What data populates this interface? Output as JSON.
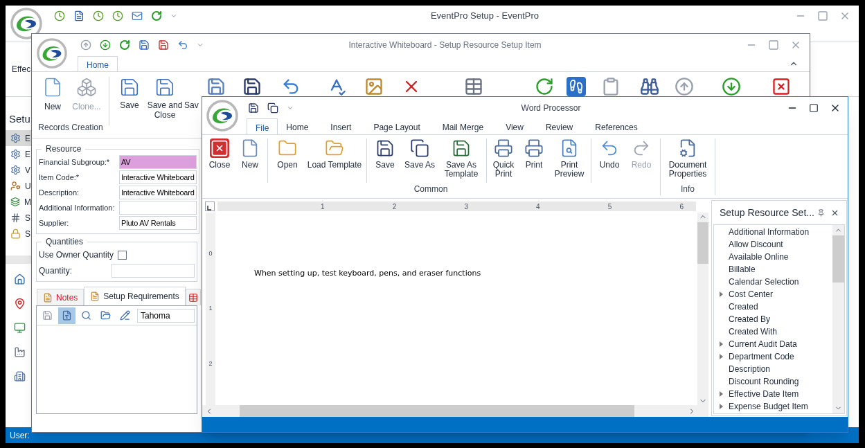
{
  "main_window": {
    "title": "EventPro Setup - EventPro",
    "ribbon_label": "Effec",
    "sidebar": {
      "title": "Setu",
      "items": [
        {
          "label": "E",
          "selected": true
        },
        {
          "label": "E",
          "selected": false
        },
        {
          "label": "V",
          "selected": false
        },
        {
          "label": "U",
          "selected": false
        },
        {
          "label": "M",
          "selected": false
        },
        {
          "label": "S",
          "selected": false
        },
        {
          "label": "S",
          "selected": false
        }
      ]
    },
    "status_bar": "User:"
  },
  "item_window": {
    "title": "Interactive Whiteboard - Setup Resource Setup Item",
    "tabs": [
      {
        "label": "Home",
        "selected": true
      }
    ],
    "ribbon": {
      "group_label": "Records Creation",
      "buttons": [
        {
          "label": "New",
          "disabled": false
        },
        {
          "label": "Clone...",
          "disabled": true
        },
        {
          "label": "Save",
          "disabled": false
        },
        {
          "label": "Save and Close",
          "disabled": false
        },
        {
          "label": "Sav",
          "disabled": false
        }
      ]
    },
    "resource": {
      "title": "Resource",
      "fields": [
        {
          "label": "Financial Subgroup:*",
          "value": "AV",
          "highlighted": true
        },
        {
          "label": "Item Code:*",
          "value": "Interactive Whiteboard",
          "highlighted": false
        },
        {
          "label": "Description:",
          "value": "Interactive Whiteboard",
          "highlighted": false
        },
        {
          "label": "Additional Information:",
          "highlighted": false
        },
        {
          "label": "Supplier:",
          "value": "Pluto AV Rentals",
          "highlighted": false
        }
      ]
    },
    "quantities": {
      "title": "Quantities",
      "use_owner_quantity": {
        "label": "Use Owner Quantity",
        "checked": false
      },
      "quantity": {
        "label": "Quantity:"
      }
    },
    "detail_tabs": [
      {
        "label": "Notes",
        "selected": false,
        "flagged": true
      },
      {
        "label": "Setup Requirements",
        "selected": true,
        "flagged": false
      }
    ],
    "editor_toolbar": {
      "tools": [
        {
          "disabled": true,
          "selected": false
        },
        {
          "disabled": false,
          "selected": true
        },
        {
          "disabled": false,
          "selected": false
        },
        {
          "disabled": false,
          "selected": false
        },
        {
          "disabled": false,
          "selected": false
        }
      ],
      "font": "Tahoma"
    }
  },
  "word_processor": {
    "title": "Word Processor",
    "tabs": [
      {
        "label": "File",
        "selected": true
      },
      {
        "label": "Home",
        "selected": false
      },
      {
        "label": "Insert",
        "selected": false
      },
      {
        "label": "Page Layout",
        "selected": false
      },
      {
        "label": "Mail Merge",
        "selected": false
      },
      {
        "label": "View",
        "selected": false
      },
      {
        "label": "Review",
        "selected": false
      },
      {
        "label": "References",
        "selected": false
      }
    ],
    "ribbon_groups": [
      {
        "label": "Common",
        "sections": [
          [
            {
              "label": "Close",
              "disabled": false
            },
            {
              "label": "New",
              "disabled": false
            }
          ],
          [
            {
              "label": "Open",
              "disabled": false
            },
            {
              "label": "Load Template",
              "disabled": false
            }
          ],
          [
            {
              "label": "Save",
              "disabled": false
            },
            {
              "label": "Save As",
              "disabled": false
            },
            {
              "label": "Save As Template",
              "disabled": false
            }
          ],
          [
            {
              "label": "Quick Print",
              "disabled": false
            },
            {
              "label": "Print",
              "disabled": false
            },
            {
              "label": "Print Preview",
              "disabled": false
            }
          ],
          [
            {
              "label": "Undo",
              "disabled": false
            },
            {
              "label": "Redo",
              "disabled": true
            }
          ]
        ]
      },
      {
        "label": "Info",
        "sections": [
          [
            {
              "label": "Document Properties",
              "disabled": false
            }
          ]
        ]
      }
    ],
    "ruler_numbers": [
      "1",
      "2",
      "3",
      "4",
      "5",
      "6"
    ],
    "vertical_ruler_numbers": [
      "0",
      "1",
      "2"
    ],
    "document_text": "When setting up, test keyboard, pens, and eraser functions",
    "side_panel": {
      "title": "Setup Resource Set...",
      "items": [
        {
          "label": "Additional Information",
          "expandable": false
        },
        {
          "label": "Allow Discount",
          "expandable": false
        },
        {
          "label": "Available Online",
          "expandable": false
        },
        {
          "label": "Billable",
          "expandable": false
        },
        {
          "label": "Calendar Selection",
          "expandable": false
        },
        {
          "label": "Cost Center",
          "expandable": true
        },
        {
          "label": "Created",
          "expandable": false
        },
        {
          "label": "Created By",
          "expandable": false
        },
        {
          "label": "Created With",
          "expandable": false
        },
        {
          "label": "Current Audit Data",
          "expandable": true
        },
        {
          "label": "Department Code",
          "expandable": true
        },
        {
          "label": "Description",
          "expandable": false
        },
        {
          "label": "Discount Rounding",
          "expandable": false
        },
        {
          "label": "Effective Date Item",
          "expandable": true
        },
        {
          "label": "Expense Budget Item",
          "expandable": true
        }
      ]
    }
  }
}
